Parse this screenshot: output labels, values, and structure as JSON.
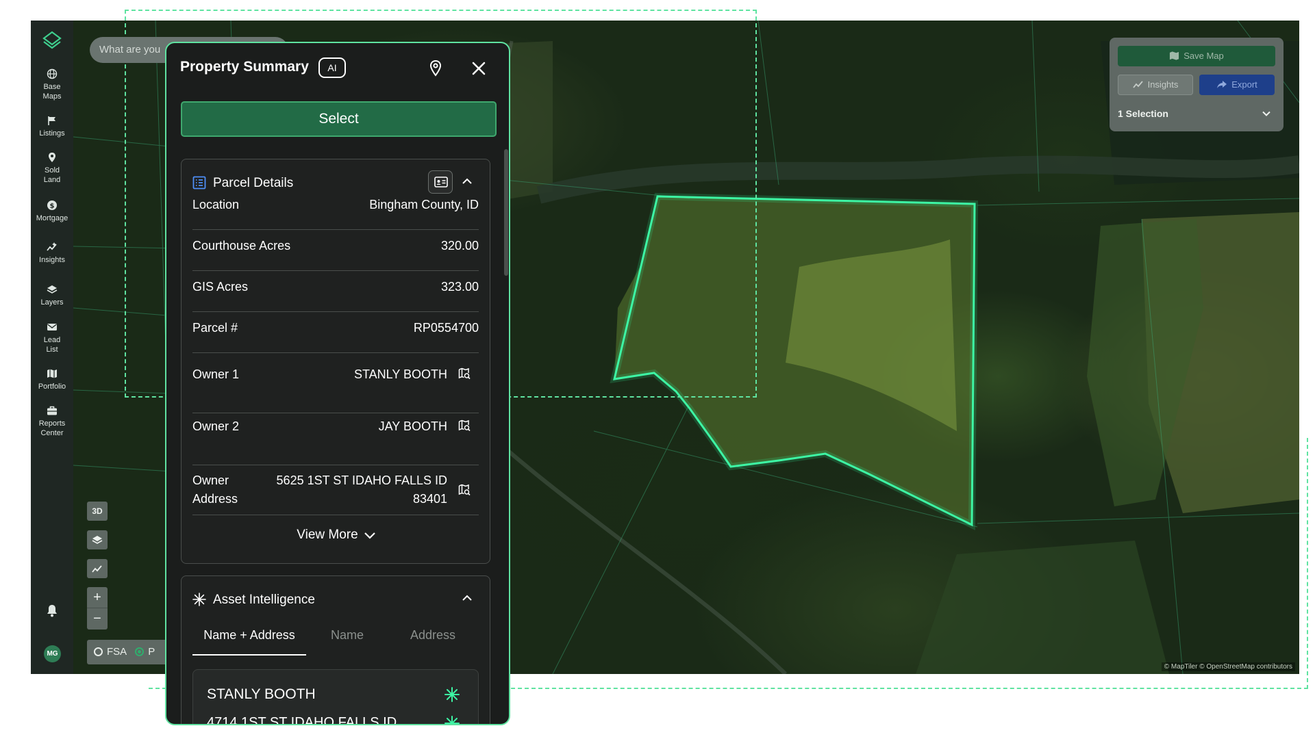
{
  "search": {
    "placeholder": "What are you"
  },
  "rail": {
    "items": [
      {
        "label": "Base Maps",
        "icon": "globe-icon"
      },
      {
        "label": "Listings",
        "icon": "flag-icon"
      },
      {
        "label": "Sold Land",
        "icon": "map-pin-icon"
      },
      {
        "label": "Mortgage",
        "icon": "dollar-icon"
      },
      {
        "label": "Insights",
        "icon": "insights-icon"
      },
      {
        "label": "Layers",
        "icon": "layers-icon"
      },
      {
        "label": "Lead List",
        "icon": "mail-icon"
      },
      {
        "label": "Portfolio",
        "icon": "map-icon"
      },
      {
        "label": "Reports Center",
        "icon": "briefcase-icon"
      }
    ],
    "avatar": "MG"
  },
  "map_controls": {
    "view_3d": "3D",
    "zoom_in": "+",
    "zoom_out": "−",
    "fsa_label": "FSA",
    "p_label": "P"
  },
  "attribution": "© MapTiler © OpenStreetMap contributors",
  "toolbar": {
    "save_map": "Save Map",
    "insights": "Insights",
    "export": "Export",
    "selection": "1 Selection"
  },
  "panel": {
    "title": "Property Summary",
    "ai_badge": "AI",
    "select_label": "Select",
    "parcel": {
      "header": "Parcel Details",
      "rows": [
        {
          "label": "Location",
          "value": "Bingham County, ID"
        },
        {
          "label": "Courthouse Acres",
          "value": "320.00"
        },
        {
          "label": "GIS Acres",
          "value": "323.00"
        },
        {
          "label": "Parcel #",
          "value": "RP0554700"
        },
        {
          "label": "Owner 1",
          "value": "STANLY BOOTH"
        },
        {
          "label": "Owner 2",
          "value": "JAY BOOTH"
        },
        {
          "label": "Owner Address",
          "value": "5625 1ST ST IDAHO FALLS ID 83401"
        }
      ],
      "view_more": "View More"
    },
    "asset": {
      "header": "Asset Intelligence",
      "tabs": [
        "Name + Address",
        "Name",
        "Address"
      ],
      "active_tab": "Name + Address",
      "result_name": "STANLY BOOTH",
      "result_address": "4714 1ST ST IDAHO FALLS ID"
    }
  },
  "colors": {
    "accent": "#5fe3a1",
    "select": "#226b46",
    "export": "#1e3f8a",
    "panel_bg": "#1b1d1c"
  }
}
